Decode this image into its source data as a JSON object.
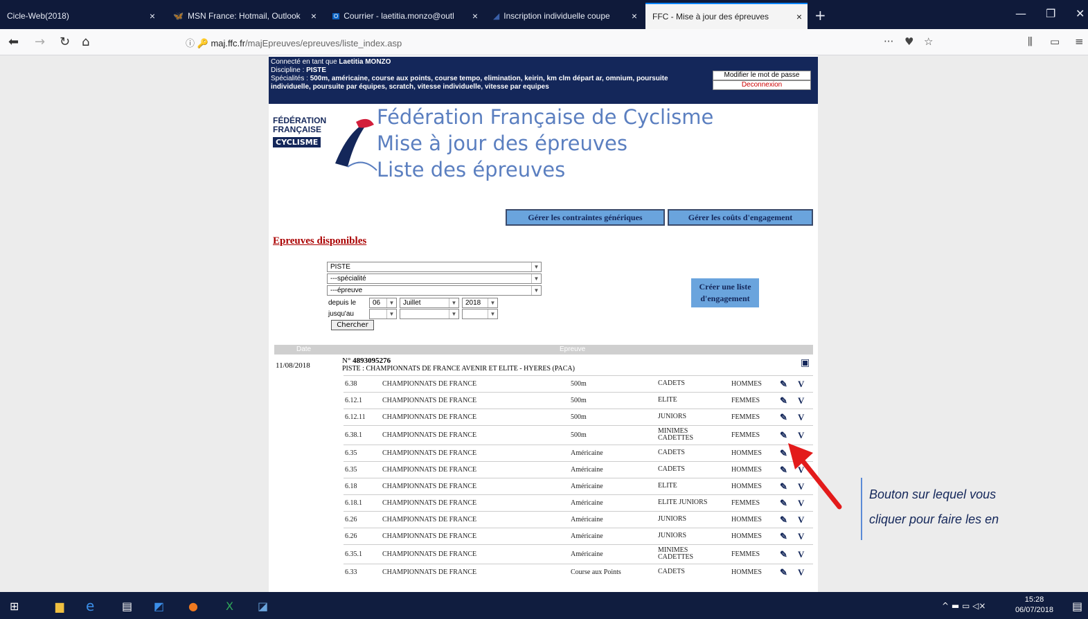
{
  "tabs": [
    {
      "label": "Cicle-Web(2018)",
      "close": "×"
    },
    {
      "label": "MSN France: Hotmail, Outlook",
      "close": "×"
    },
    {
      "label": "Courrier - laetitia.monzo@outl",
      "close": "×"
    },
    {
      "label": "Inscription individuelle coupe",
      "close": "×"
    },
    {
      "label": "FFC - Mise à jour des épreuves",
      "close": "×"
    }
  ],
  "new_tab": "+",
  "url": {
    "domain": "maj.ffc.fr",
    "path": "/majEpreuves/epreuves/liste_index.asp"
  },
  "header": {
    "connected_prefix": "Connecté en tant que ",
    "user": "Laetitia MONZO",
    "discipline_label": "Discipline : ",
    "discipline": "PISTE",
    "specialites_label": "Spécialités : ",
    "specialites": "500m, américaine, course aux points, course tempo, elimination, keirin, km clm départ ar, omnium, poursuite individuelle, poursuite par équipes, scratch, vitesse individuelle, vitesse par equipes",
    "change_password": "Modifier le mot de passe",
    "logout": "Deconnexion"
  },
  "logo": {
    "line1": "FÉDÉRATION",
    "line2": "FRANÇAISE",
    "line3": "CYCLISME"
  },
  "titles": {
    "t1": "Fédération Française de Cyclisme",
    "t2": "Mise à jour des épreuves",
    "t3": "Liste des épreuves"
  },
  "buttons": {
    "constraints": "Gérer les contraintes génériques",
    "costs": "Gérer les coûts d'engagement",
    "search": "Chercher",
    "create": "Créer une liste d'engagement"
  },
  "section_title": "Epreuves disponibles",
  "filters": {
    "discipline": "PISTE",
    "specialite": "---spécialité",
    "epreuve": "---épreuve",
    "depuis_label": "depuis le",
    "jusqu_label": "jusqu'au",
    "from_day": "06",
    "from_month": "Juillet",
    "from_year": "2018"
  },
  "table_headers": {
    "date": "Date",
    "epreuve": "Epreuve"
  },
  "event": {
    "date": "11/08/2018",
    "num_prefix": "N° ",
    "num": "4893095276",
    "title": "PISTE : CHAMPIONNATS DE FRANCE AVENIR ET ELITE - HYERES (PACA)"
  },
  "rows": [
    {
      "code": "6.38",
      "name": "CHAMPIONNATS DE FRANCE",
      "spec": "500m",
      "cat": "CADETS",
      "sex": "HOMMES"
    },
    {
      "code": "6.12.1",
      "name": "CHAMPIONNATS DE FRANCE",
      "spec": "500m",
      "cat": "ELITE",
      "sex": "FEMMES"
    },
    {
      "code": "6.12.11",
      "name": "CHAMPIONNATS DE FRANCE",
      "spec": "500m",
      "cat": "JUNIORS",
      "sex": "FEMMES"
    },
    {
      "code": "6.38.1",
      "name": "CHAMPIONNATS DE FRANCE",
      "spec": "500m",
      "cat": "MINIMES CADETTES",
      "sex": "FEMMES"
    },
    {
      "code": "6.35",
      "name": "CHAMPIONNATS DE FRANCE",
      "spec": "Américaine",
      "cat": "CADETS",
      "sex": "HOMMES"
    },
    {
      "code": "6.35",
      "name": "CHAMPIONNATS DE FRANCE",
      "spec": "Américaine",
      "cat": "CADETS",
      "sex": "HOMMES"
    },
    {
      "code": "6.18",
      "name": "CHAMPIONNATS DE FRANCE",
      "spec": "Américaine",
      "cat": "ELITE",
      "sex": "HOMMES"
    },
    {
      "code": "6.18.1",
      "name": "CHAMPIONNATS DE FRANCE",
      "spec": "Américaine",
      "cat": "ELITE JUNIORS",
      "sex": "FEMMES"
    },
    {
      "code": "6.26",
      "name": "CHAMPIONNATS DE FRANCE",
      "spec": "Américaine",
      "cat": "JUNIORS",
      "sex": "HOMMES"
    },
    {
      "code": "6.26",
      "name": "CHAMPIONNATS DE FRANCE",
      "spec": "Américaine",
      "cat": "JUNIORS",
      "sex": "HOMMES"
    },
    {
      "code": "6.35.1",
      "name": "CHAMPIONNATS DE FRANCE",
      "spec": "Américaine",
      "cat": "MINIMES CADETTES",
      "sex": "FEMMES"
    },
    {
      "code": "6.33",
      "name": "CHAMPIONNATS DE FRANCE",
      "spec": "Course aux Points",
      "cat": "CADETS",
      "sex": "HOMMES"
    }
  ],
  "row_icons": {
    "edit": "✎",
    "check": "V"
  },
  "annotation": {
    "line1": "Bouton sur lequel vous",
    "line2": "cliquer pour faire les en"
  },
  "clock": {
    "time": "15:28",
    "date": "06/07/2018"
  },
  "colors": {
    "header_bg": "#14275a",
    "title_blue": "#5b7fc0",
    "button_blue": "#6aa4dd",
    "section_red": "#aa0000",
    "arrow_red": "#e31b1b"
  }
}
